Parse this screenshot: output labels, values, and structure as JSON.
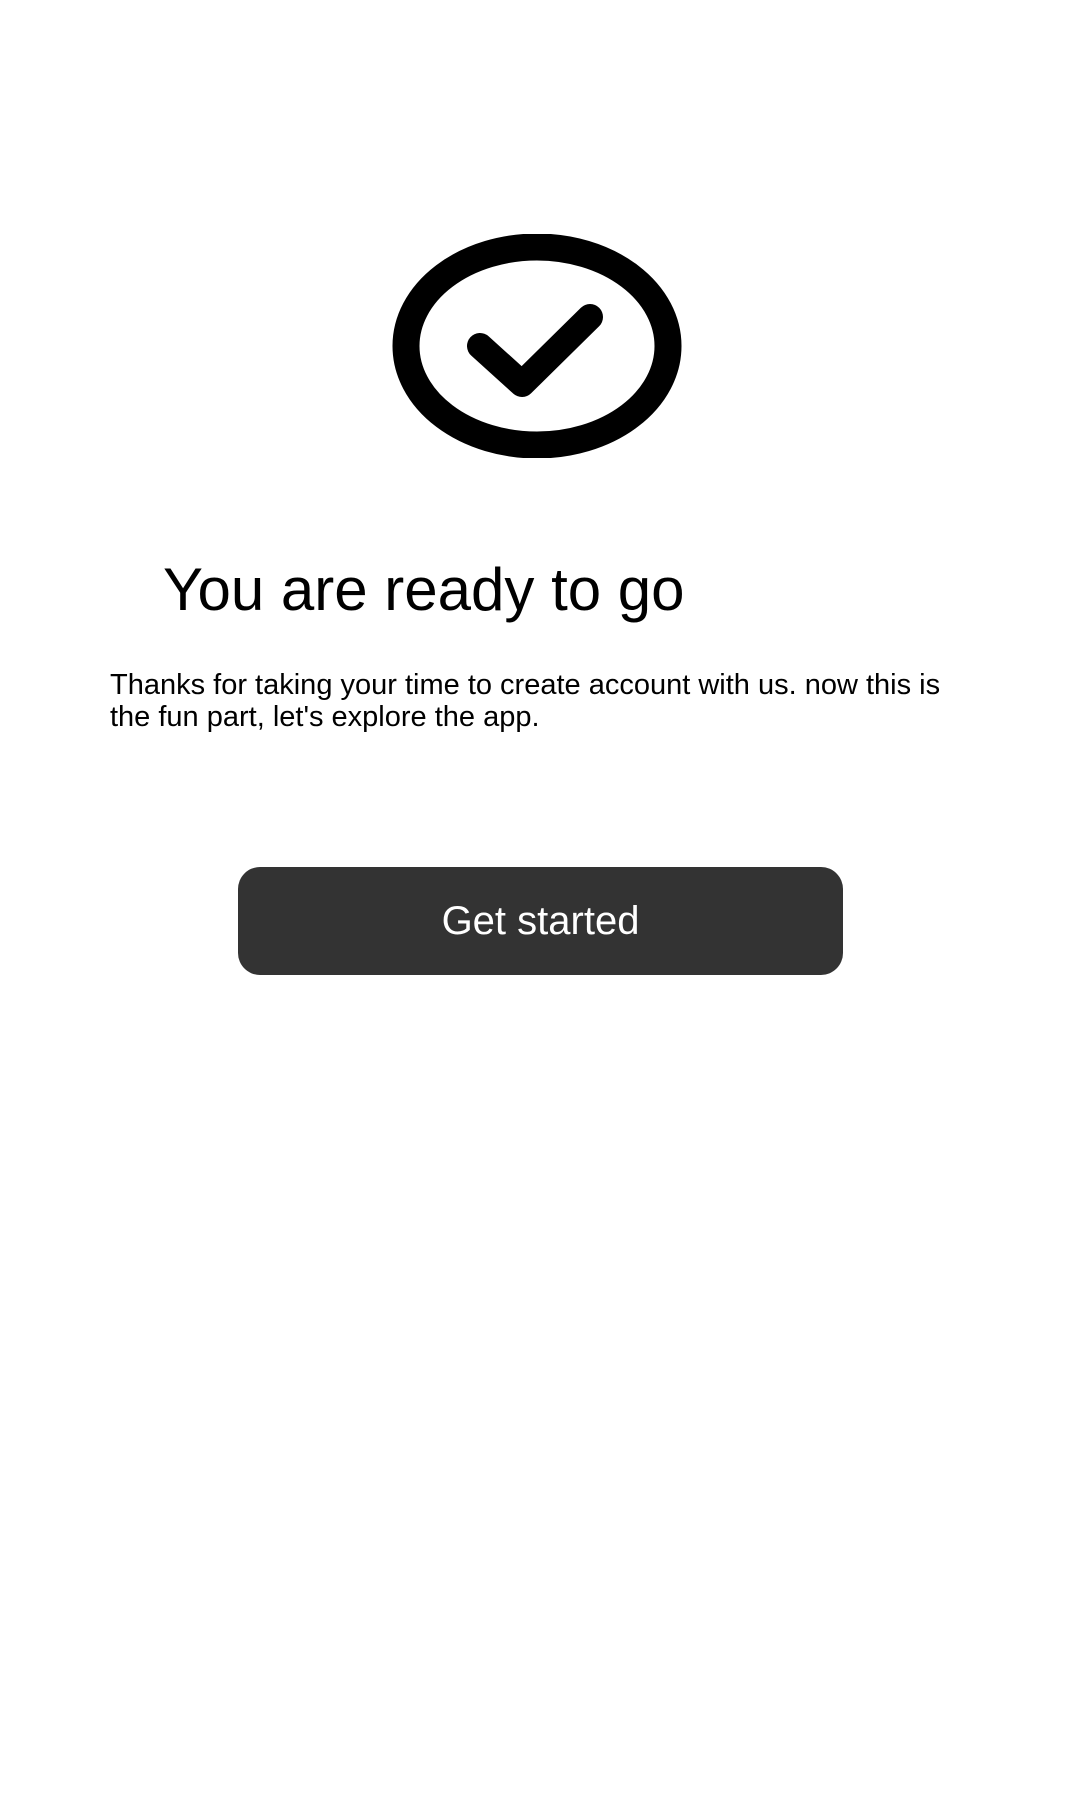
{
  "onboarding_complete": {
    "icon": "check-circle-icon",
    "title": "You are ready to go",
    "description": "Thanks for taking your time to create account with us. now this is the fun part, let's explore the app.",
    "button_label": "Get started"
  },
  "colors": {
    "background": "#ffffff",
    "text": "#000000",
    "button_background": "#333333",
    "button_text": "#ffffff"
  }
}
